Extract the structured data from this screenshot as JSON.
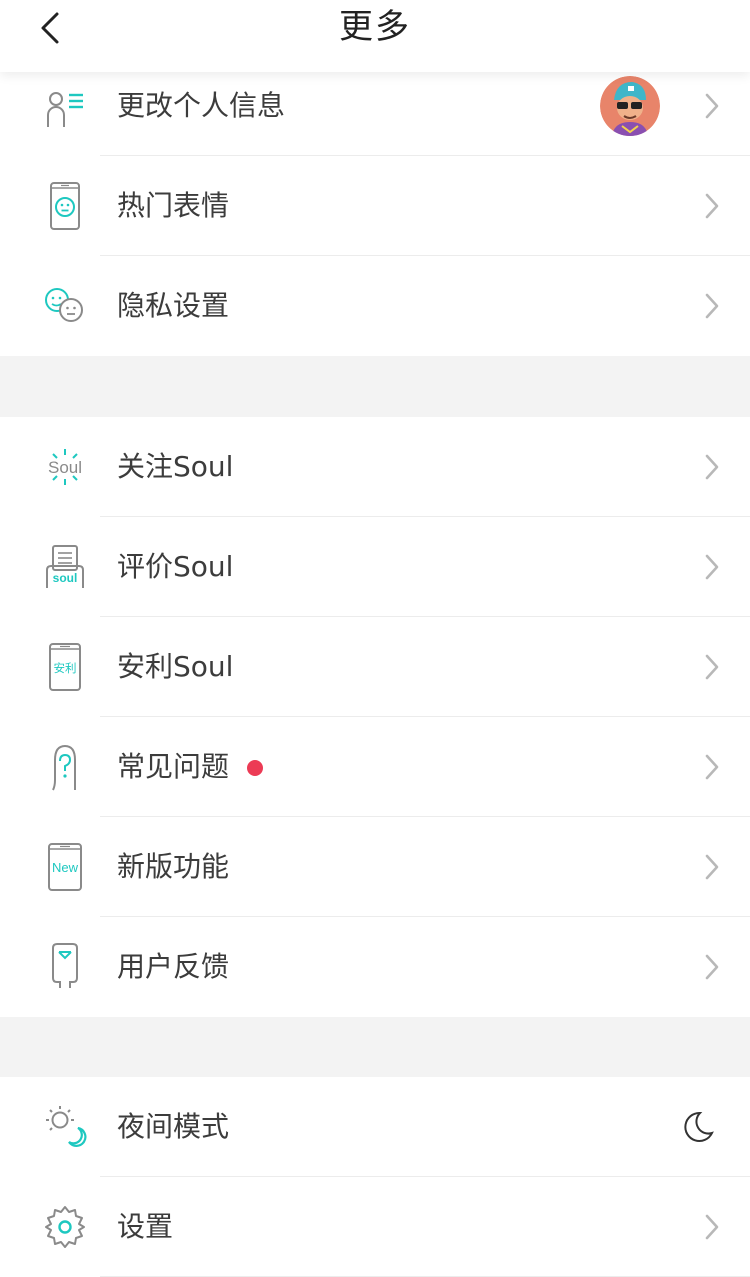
{
  "header": {
    "title": "更多",
    "back_icon": "back-arrow-icon"
  },
  "colors": {
    "accent": "#1ec8c0",
    "icon_gray": "#8a8a8a",
    "badge_red": "#ec3b55",
    "background": "#f3f3f3"
  },
  "group1": {
    "items": [
      {
        "label": "更改个人信息",
        "icon": "profile-edit-icon",
        "has_avatar": true
      },
      {
        "label": "热门表情",
        "icon": "emoji-phone-icon"
      },
      {
        "label": "隐私设置",
        "icon": "privacy-faces-icon"
      }
    ]
  },
  "group2": {
    "items": [
      {
        "label": "关注Soul",
        "icon": "soul-logo-icon",
        "icon_text": "Soul"
      },
      {
        "label": "评价Soul",
        "icon": "rate-soul-icon",
        "icon_text": "soul"
      },
      {
        "label": "安利Soul",
        "icon": "recommend-soul-icon",
        "icon_text": "安利"
      },
      {
        "label": "常见问题",
        "icon": "question-icon",
        "badge": "red-dot"
      },
      {
        "label": "新版功能",
        "icon": "new-features-icon",
        "icon_text": "New"
      },
      {
        "label": "用户反馈",
        "icon": "feedback-icon"
      }
    ]
  },
  "group3": {
    "items": [
      {
        "label": "夜间模式",
        "icon": "night-mode-icon",
        "trailing": "moon-icon"
      },
      {
        "label": "设置",
        "icon": "gear-icon"
      }
    ]
  }
}
